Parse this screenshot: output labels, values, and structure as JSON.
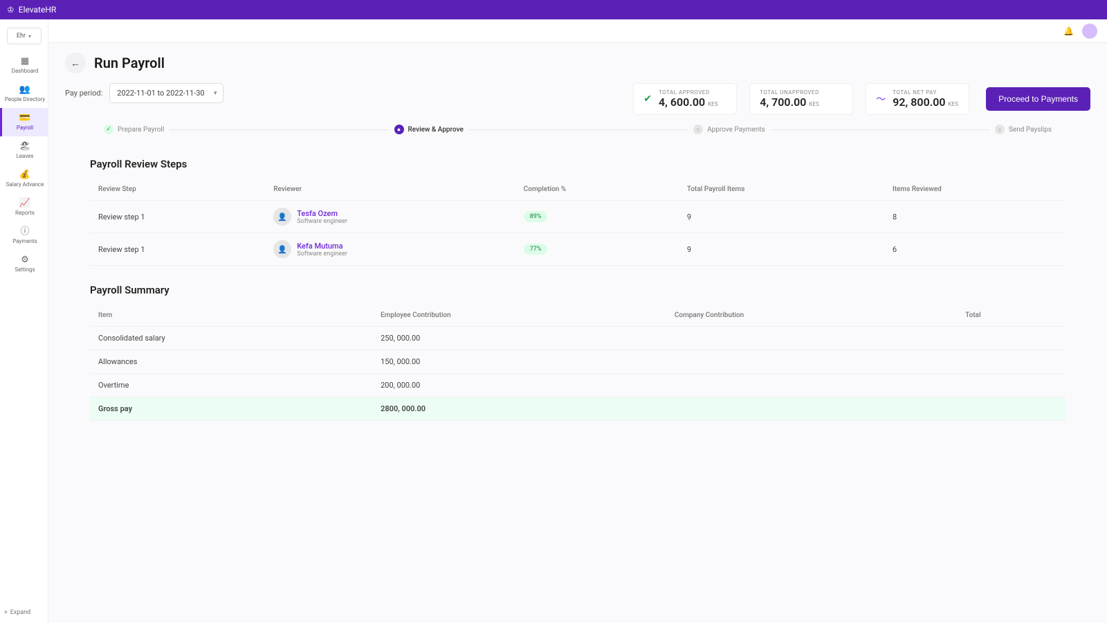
{
  "titlebar": {
    "name": "ElevateHR"
  },
  "org_badge": {
    "label": "Ehr"
  },
  "sidebar": {
    "items": [
      {
        "label": "Dashboard",
        "icon": "▦"
      },
      {
        "label": "People Directory",
        "icon": "👥"
      },
      {
        "label": "Payroll",
        "icon": "💳",
        "active": true
      },
      {
        "label": "Leaves",
        "icon": "🏖"
      },
      {
        "label": "Salary Advance",
        "icon": "💰"
      },
      {
        "label": "Reports",
        "icon": "📈"
      },
      {
        "label": "Payments",
        "icon": "ⓘ"
      },
      {
        "label": "Settings",
        "icon": "⚙"
      }
    ],
    "expand": "Expand"
  },
  "page": {
    "title": "Run Payroll",
    "period_label": "Pay period:",
    "period_value": "2022-11-01 to 2022-11-30",
    "proceed": "Proceed to Payments"
  },
  "kpis": [
    {
      "label": "TOTAL APPROVED",
      "value": "4, 600.00",
      "currency": "KES",
      "icon": "✔",
      "iconClass": "green"
    },
    {
      "label": "TOTAL UNAPPROVED",
      "value": "4, 700.00",
      "currency": "KES",
      "icon": "",
      "iconClass": ""
    },
    {
      "label": "TOTAL NET PAY",
      "value": "92, 800.00",
      "currency": "KES",
      "icon": "〜",
      "iconClass": "purple"
    }
  ],
  "stepper": [
    {
      "label": "Prepare Payroll",
      "state": "done"
    },
    {
      "label": "Review & Approve",
      "state": "active"
    },
    {
      "label": "Approve Payments",
      "state": "pending"
    },
    {
      "label": "Send Payslips",
      "state": "pending"
    }
  ],
  "review": {
    "title": "Payroll Review Steps",
    "headers": [
      "Review Step",
      "Reviewer",
      "Completion %",
      "Total Payroll Items",
      "Items Reviewed"
    ],
    "rows": [
      {
        "step": "Review step 1",
        "reviewer": "Tesfa Ozem",
        "role": "Software engineer",
        "completion": "89%",
        "total": "9",
        "reviewed": "8"
      },
      {
        "step": "Review step 1",
        "reviewer": "Kefa Mutuma",
        "role": "Software engineer",
        "completion": "77%",
        "total": "9",
        "reviewed": "6"
      }
    ]
  },
  "summary": {
    "title": "Payroll Summary",
    "headers": [
      "Item",
      "Employee Contribution",
      "Company Contribution",
      "Total"
    ],
    "rows": [
      {
        "item": "Consolidated salary",
        "emp": "250, 000.00",
        "comp": "",
        "total": "",
        "highlight": false
      },
      {
        "item": "Allowances",
        "emp": "150, 000.00",
        "comp": "",
        "total": "",
        "highlight": false
      },
      {
        "item": "Overtime",
        "emp": "200, 000.00",
        "comp": "",
        "total": "",
        "highlight": false
      },
      {
        "item": "Gross pay",
        "emp": "2800, 000.00",
        "comp": "",
        "total": "",
        "highlight": true
      }
    ]
  }
}
